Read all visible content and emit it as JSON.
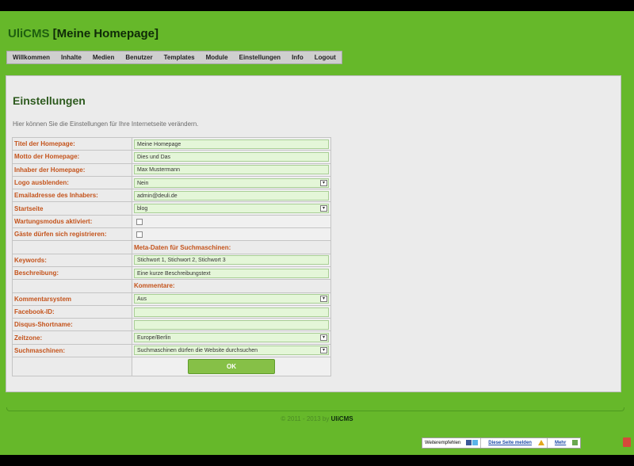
{
  "site": {
    "brand": "UliCMS",
    "title": "[Meine Homepage]"
  },
  "nav": [
    "Willkommen",
    "Inhalte",
    "Medien",
    "Benutzer",
    "Templates",
    "Module",
    "Einstellungen",
    "Info",
    "Logout"
  ],
  "page": {
    "heading": "Einstellungen",
    "intro": "Hier können Sie die Einstellungen für Ihre Internetseite verändern."
  },
  "form": {
    "homepage_title": {
      "label": "Titel der Homepage:",
      "value": "Meine Homepage"
    },
    "homepage_motto": {
      "label": "Motto der Homepage:",
      "value": "Dies und Das"
    },
    "homepage_owner": {
      "label": "Inhaber der Homepage:",
      "value": "Max Mustermann"
    },
    "hide_logo": {
      "label": "Logo ausblenden:",
      "value": "Nein"
    },
    "owner_email": {
      "label": "Emailadresse des Inhabers:",
      "value": "admin@deuli.de"
    },
    "start_page": {
      "label": "Startseite",
      "value": "blog"
    },
    "maintenance": {
      "label": "Wartungsmodus aktiviert:"
    },
    "guest_register": {
      "label": "Gäste dürfen sich registrieren:"
    },
    "meta_section": "Meta-Daten für Suchmaschinen:",
    "keywords": {
      "label": "Keywords:",
      "value": "Stichwort 1, Stichwort 2, Stichwort 3"
    },
    "description": {
      "label": "Beschreibung:",
      "value": "Eine kurze Beschreibungstext"
    },
    "comments_section": "Kommentare:",
    "comment_system": {
      "label": "Kommentarsystem",
      "value": "Aus"
    },
    "facebook_id": {
      "label": "Facebook-ID:",
      "value": ""
    },
    "disqus_shortname": {
      "label": "Disqus-Shortname:",
      "value": ""
    },
    "timezone": {
      "label": "Zeitzone:",
      "value": "Europe/Berlin"
    },
    "search_engines": {
      "label": "Suchmaschinen:",
      "value": "Suchmaschinen dürfen die Website durchsuchen"
    },
    "ok_label": "OK"
  },
  "footer": {
    "text": "© 2011 - 2013 by",
    "brand": "UliCMS"
  },
  "widget": {
    "recommend": "Weiterempfehlen",
    "report": "Diese Seite melden",
    "more": "Mehr"
  },
  "colors": {
    "frame": "#66b82a",
    "label": "#c4531b",
    "heading": "#2d5a1e",
    "input_bg": "#e4f6d8"
  }
}
